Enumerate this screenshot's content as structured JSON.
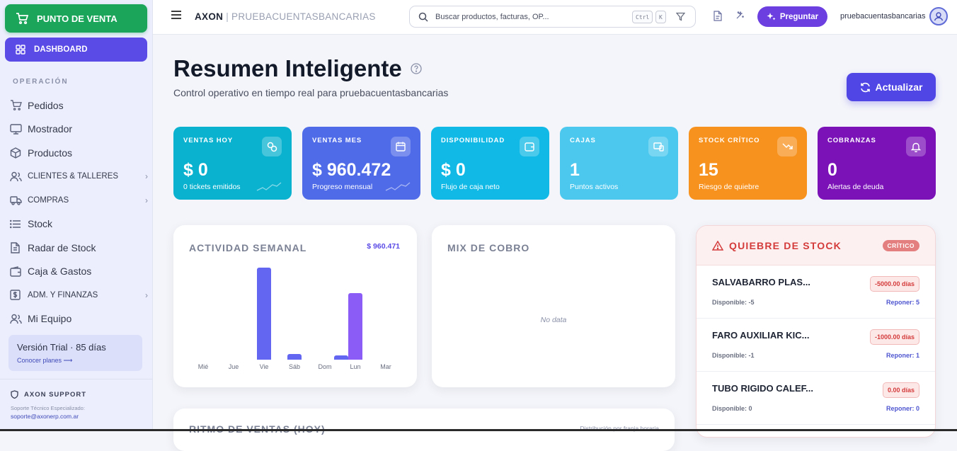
{
  "sidebar": {
    "pos_button": "PUNTO DE VENTA",
    "dashboard_button": "DASHBOARD",
    "section_title": "OPERACIÓN",
    "items": [
      {
        "label": "Pedidos",
        "icon": "cart-icon"
      },
      {
        "label": "Mostrador",
        "icon": "monitor-icon"
      },
      {
        "label": "Productos",
        "icon": "box-icon"
      },
      {
        "label": "CLIENTES & TALLERES",
        "icon": "users-icon"
      },
      {
        "label": "COMPRAS",
        "icon": "truck-icon"
      },
      {
        "label": "Stock",
        "icon": "list-icon"
      },
      {
        "label": "Radar de Stock",
        "icon": "document-icon"
      },
      {
        "label": "Caja & Gastos",
        "icon": "wallet-icon"
      },
      {
        "label": "ADM. Y FINANZAS",
        "icon": "dollar-icon"
      },
      {
        "label": "Mi Equipo",
        "icon": "team-icon"
      }
    ],
    "trial_text": "Versión Trial · 85 días",
    "trial_link": "Conocer planes ⟶",
    "support_title": "AXON SUPPORT",
    "support_sub": "Soporte Técnico Especializado:",
    "support_email": "soporte@axonerp.com.ar"
  },
  "topbar": {
    "brand": "AXON",
    "separator": "|",
    "company": "PRUEBACUENTASBANCARIAS",
    "search_placeholder": "Buscar productos, facturas, OP...",
    "kbd_ctrl": "Ctrl",
    "kbd_k": "K",
    "ask_label": "Preguntar",
    "username": "pruebacuentasbancarias"
  },
  "header": {
    "title": "Resumen Inteligente",
    "subtitle": "Control operativo en tiempo real para pruebacuentasbancarias",
    "refresh_label": "Actualizar"
  },
  "kpis": [
    {
      "label": "VENTAS HOY",
      "value": "$ 0",
      "sub": "0 tickets emitidos",
      "color": "#0ab2cf",
      "icon": "link-icon"
    },
    {
      "label": "VENTAS MES",
      "value": "$ 960.472",
      "sub": "Progreso mensual",
      "color": "#4f6be8",
      "icon": "calendar-icon"
    },
    {
      "label": "DISPONIBILIDAD",
      "value": "$ 0",
      "sub": "Flujo de caja neto",
      "color": "#10b9e6",
      "icon": "wallet-icon"
    },
    {
      "label": "CAJAS",
      "value": "1",
      "sub": "Puntos activos",
      "color": "#4cc8ee",
      "icon": "devices-icon"
    },
    {
      "label": "STOCK CRÍTICO",
      "value": "15",
      "sub": "Riesgo de quiebre",
      "color": "#f7921e",
      "icon": "trend-down-icon"
    },
    {
      "label": "COBRANZAS",
      "value": "0",
      "sub": "Alertas de deuda",
      "color": "#7a12b8",
      "icon": "bell-icon"
    }
  ],
  "weekly": {
    "title": "ACTIVIDAD SEMANAL",
    "amount": "$ 960.471"
  },
  "chart_data": {
    "type": "bar",
    "categories": [
      "Mié",
      "Jue",
      "Vie",
      "Sáb",
      "Dom",
      "Lun",
      "Mar"
    ],
    "values": [
      0,
      0,
      100,
      6,
      0,
      4.5,
      72
    ],
    "note_x_positions": "bars offset per category",
    "ylim": [
      0,
      100
    ],
    "colors": [
      "#6366f1",
      "#6366f1",
      "#6366f1",
      "#6366f1",
      "#6366f1",
      "#6366f1",
      "#8b5cf6"
    ]
  },
  "mix": {
    "title": "MIX DE COBRO",
    "empty": "No data"
  },
  "stock": {
    "title": "QUIEBRE DE STOCK",
    "badge": "CRÍTICO",
    "rows": [
      {
        "name": "SALVABARRO PLAS...",
        "days": "-5000.00 días",
        "disp": "Disponible: -5",
        "rep": "Reponer: 5"
      },
      {
        "name": "FARO AUXILIAR KIC...",
        "days": "-1000.00 días",
        "disp": "Disponible: -1",
        "rep": "Reponer: 1"
      },
      {
        "name": "TUBO RIGIDO CALEF...",
        "days": "0.00 días",
        "disp": "Disponible: 0",
        "rep": "Reponer: 0"
      }
    ]
  },
  "rhythm": {
    "title": "RITMO DE VENTAS (HOY)",
    "desc": "Distribución por franja horaria"
  }
}
